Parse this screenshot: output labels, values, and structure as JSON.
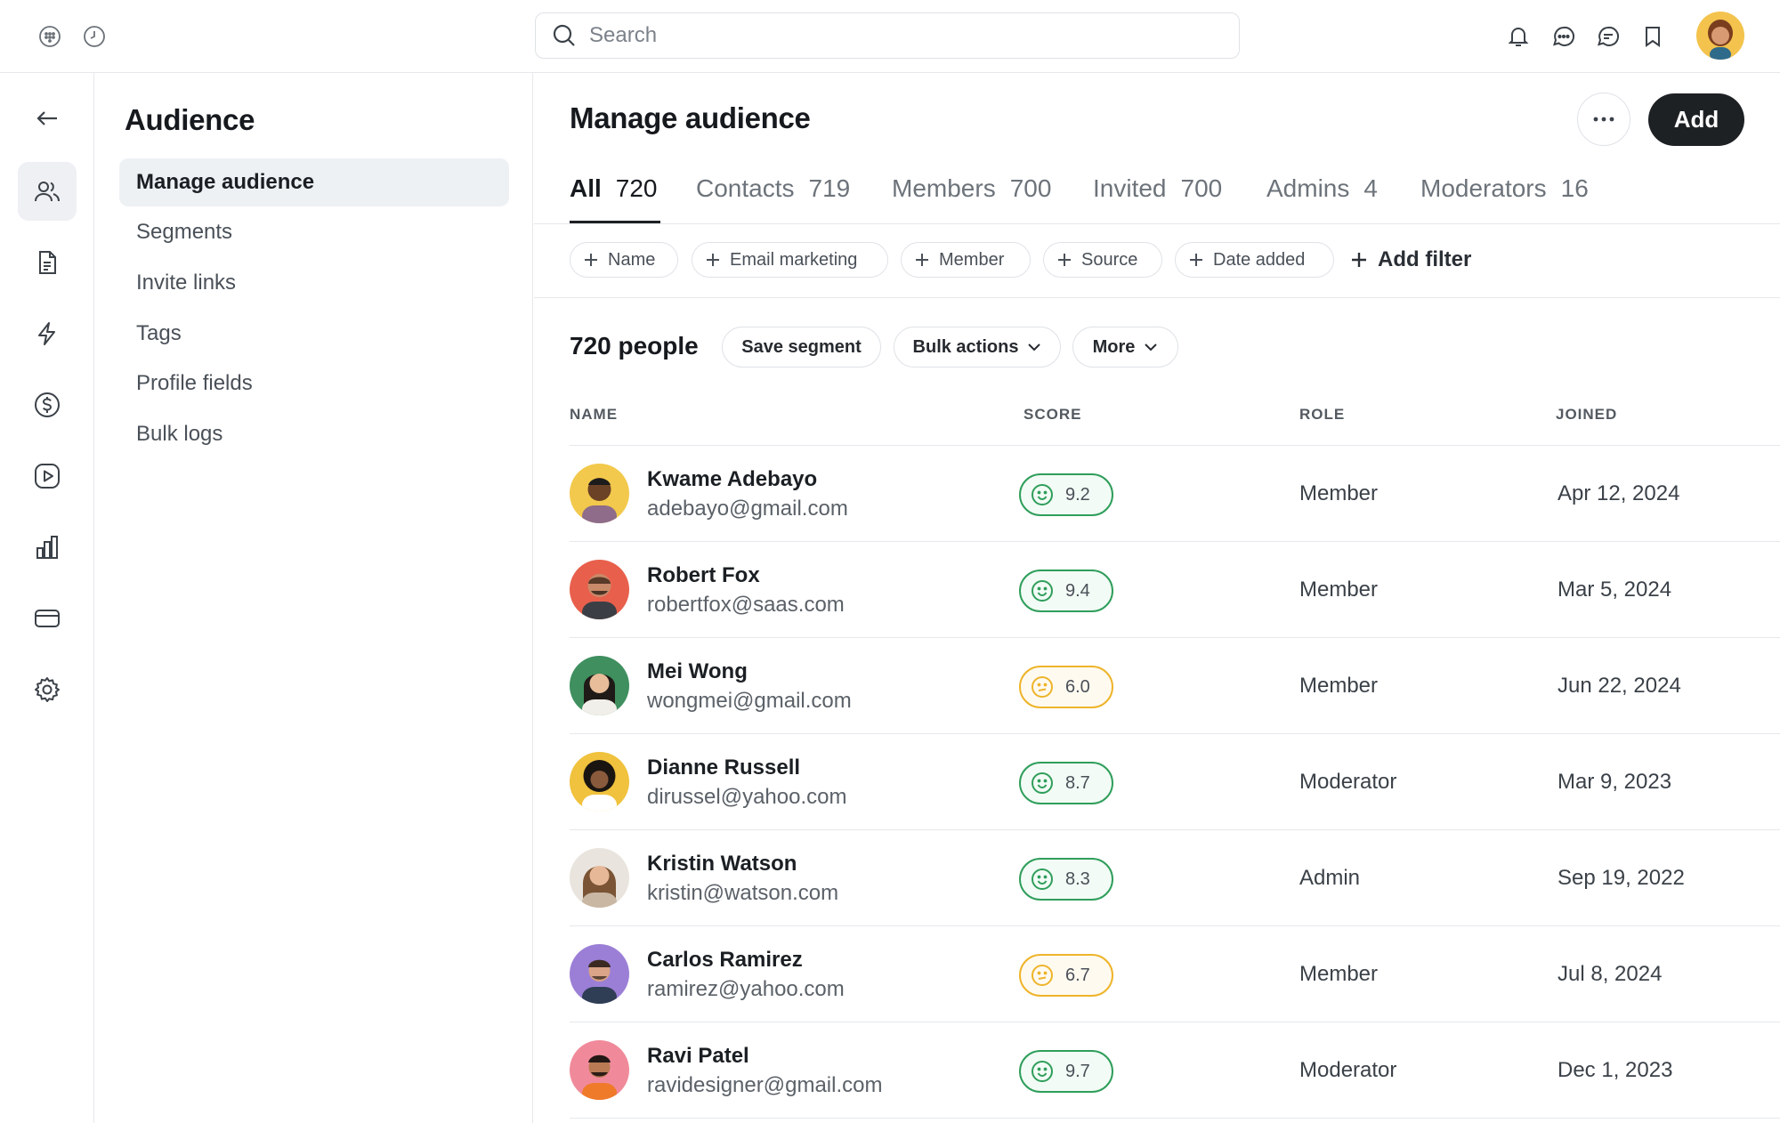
{
  "topbar": {
    "search_placeholder": "Search",
    "left_icons": [
      "grid-dots-icon",
      "clock-icon"
    ],
    "right_icons": [
      "bell-icon",
      "chat-bubble-icon",
      "message-icon",
      "bookmark-icon"
    ]
  },
  "rail": {
    "items": [
      "back-arrow-icon",
      "users-icon",
      "document-icon",
      "lightning-icon",
      "dollar-icon",
      "play-icon",
      "bar-chart-icon",
      "card-icon",
      "gear-icon"
    ],
    "active": "users-icon"
  },
  "sidebar": {
    "title": "Audience",
    "items": [
      {
        "label": "Manage audience",
        "active": true
      },
      {
        "label": "Segments"
      },
      {
        "label": "Invite links"
      },
      {
        "label": "Tags"
      },
      {
        "label": "Profile fields"
      },
      {
        "label": "Bulk logs"
      }
    ]
  },
  "main": {
    "title": "Manage audience",
    "add_label": "Add",
    "tabs": [
      {
        "label": "All",
        "count": "720",
        "active": true
      },
      {
        "label": "Contacts",
        "count": "719"
      },
      {
        "label": "Members",
        "count": "700"
      },
      {
        "label": "Invited",
        "count": "700"
      },
      {
        "label": "Admins",
        "count": "4"
      },
      {
        "label": "Moderators",
        "count": "16"
      }
    ],
    "filters": [
      "Name",
      "Email marketing",
      "Member",
      "Source",
      "Date added"
    ],
    "add_filter": "Add filter",
    "people_count": "720 people",
    "save_segment": "Save segment",
    "bulk_actions": "Bulk actions",
    "more": "More",
    "columns": {
      "name": "NAME",
      "score": "SCORE",
      "role": "ROLE",
      "joined": "JOINED"
    },
    "rows": [
      {
        "name": "Kwame Adebayo",
        "email": "adebayo@gmail.com",
        "score": "9.2",
        "mood": "happy",
        "role": "Member",
        "joined": "Apr 12, 2024"
      },
      {
        "name": "Robert Fox",
        "email": "robertfox@saas.com",
        "score": "9.4",
        "mood": "happy",
        "role": "Member",
        "joined": "Mar 5, 2024"
      },
      {
        "name": "Mei Wong",
        "email": "wongmei@gmail.com",
        "score": "6.0",
        "mood": "neutral",
        "role": "Member",
        "joined": "Jun 22, 2024"
      },
      {
        "name": "Dianne Russell",
        "email": "dirussel@yahoo.com",
        "score": "8.7",
        "mood": "happy",
        "role": "Moderator",
        "joined": "Mar 9, 2023"
      },
      {
        "name": "Kristin Watson",
        "email": "kristin@watson.com",
        "score": "8.3",
        "mood": "happy",
        "role": "Admin",
        "joined": "Sep 19, 2022"
      },
      {
        "name": "Carlos Ramirez",
        "email": "ramirez@yahoo.com",
        "score": "6.7",
        "mood": "neutral",
        "role": "Member",
        "joined": "Jul 8, 2024"
      },
      {
        "name": "Ravi Patel",
        "email": "ravidesigner@gmail.com",
        "score": "9.7",
        "mood": "happy",
        "role": "Moderator",
        "joined": "Dec 1, 2023"
      }
    ]
  },
  "colors": {
    "accent_dark": "#1e2124",
    "score_good": "#2f9e5b",
    "score_mid": "#eeb42a",
    "active_bg": "#eef1f4"
  }
}
